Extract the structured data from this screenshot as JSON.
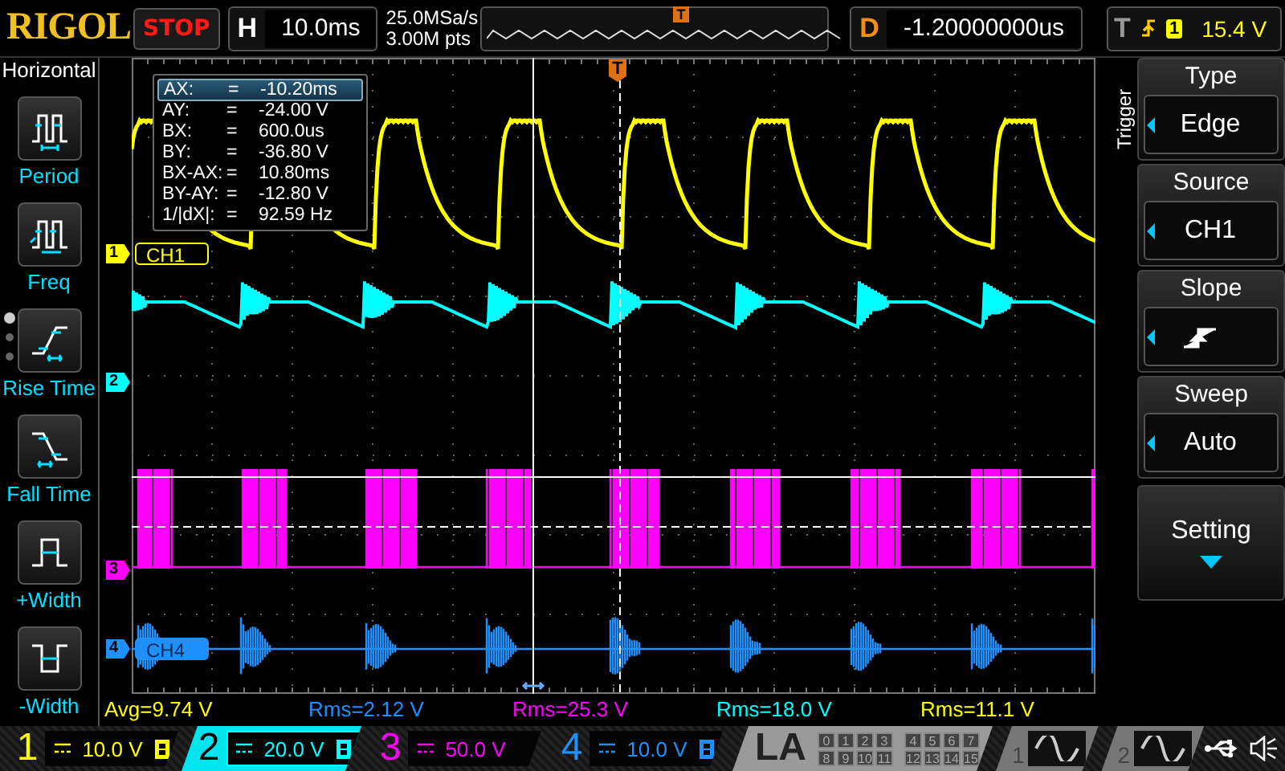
{
  "logo": "RIGOL",
  "run_state": "STOP",
  "timebase": {
    "label": "H",
    "value": "10.0ms"
  },
  "acquisition": {
    "sample_rate": "25.0MSa/s",
    "memory_depth": "3.00M pts"
  },
  "overview": {
    "marker": "T"
  },
  "delay": {
    "label": "D",
    "value": "-1.20000000us"
  },
  "trigger_status": {
    "label": "T",
    "source": "1",
    "level": "15.4 V"
  },
  "left_menu": {
    "title": "Horizontal",
    "items": [
      {
        "label": "Period",
        "kind": "period"
      },
      {
        "label": "Freq",
        "kind": "freq"
      },
      {
        "label": "Rise Time",
        "kind": "rise"
      },
      {
        "label": "Fall Time",
        "kind": "fall"
      },
      {
        "label": "+Width",
        "kind": "pwidth"
      },
      {
        "label": "-Width",
        "kind": "nwidth"
      }
    ]
  },
  "scope": {
    "trigger_marker": "T",
    "channel_markers": [
      {
        "number": "1",
        "color": "#ffff00",
        "label": "CH1",
        "filled": false
      },
      {
        "number": "2",
        "color": "#00ffff"
      },
      {
        "number": "3",
        "color": "#ff00ff"
      },
      {
        "number": "4",
        "color": "#1e90ff",
        "label": "CH4",
        "filled": true
      }
    ]
  },
  "cursor_readout": [
    {
      "name": "AX:",
      "eq": "=",
      "value": "-10.20ms",
      "selected": true
    },
    {
      "name": "AY:",
      "eq": "=",
      "value": "-24.00 V",
      "selected": false
    },
    {
      "name": "BX:",
      "eq": "=",
      "value": "600.0us",
      "selected": false
    },
    {
      "name": "BY:",
      "eq": "=",
      "value": "-36.80 V",
      "selected": false
    },
    {
      "name": "BX-AX:",
      "eq": "=",
      "value": "10.80ms",
      "selected": false
    },
    {
      "name": "BY-AY:",
      "eq": "=",
      "value": "-12.80 V",
      "selected": false
    },
    {
      "name": "1/|dX|:",
      "eq": "=",
      "value": "92.59 Hz",
      "selected": false
    }
  ],
  "right_menu": {
    "title": "Trigger",
    "items": [
      {
        "kind": "value",
        "label": "Type",
        "value": "Edge"
      },
      {
        "kind": "value",
        "label": "Source",
        "value": "CH1"
      },
      {
        "kind": "slope",
        "label": "Slope"
      },
      {
        "kind": "value",
        "label": "Sweep",
        "value": "Auto"
      },
      {
        "kind": "submenu",
        "label": "Setting"
      }
    ]
  },
  "measurements": [
    {
      "text": "Avg=9.74 V",
      "color": "#ffff00"
    },
    {
      "text": "Rms=2.12 V",
      "color": "#1e90ff"
    },
    {
      "text": "Rms=25.3 V",
      "color": "#ff00ff"
    },
    {
      "text": "Rms=18.0 V",
      "color": "#00ffff"
    },
    {
      "text": "Rms=11.1 V",
      "color": "#ffff00"
    }
  ],
  "channels": [
    {
      "number": "1",
      "scale": "10.0 V",
      "color": "#ffff00",
      "selected": false,
      "bandwidth_limit": true
    },
    {
      "number": "2",
      "scale": "20.0 V",
      "color": "#00ffff",
      "selected": true,
      "bandwidth_limit": true
    },
    {
      "number": "3",
      "scale": "50.0 V",
      "color": "#ff00ff",
      "selected": false,
      "bandwidth_limit": false
    },
    {
      "number": "4",
      "scale": "10.0 V",
      "color": "#1e90ff",
      "selected": false,
      "bandwidth_limit": true
    }
  ],
  "logic_analyzer": {
    "label": "LA",
    "bits": [
      "0",
      "1",
      "2",
      "3",
      "4",
      "5",
      "6",
      "7",
      "8",
      "9",
      "10",
      "11",
      "12",
      "13",
      "14",
      "15"
    ]
  },
  "generators": [
    {
      "number": "1"
    },
    {
      "number": "2"
    }
  ]
}
